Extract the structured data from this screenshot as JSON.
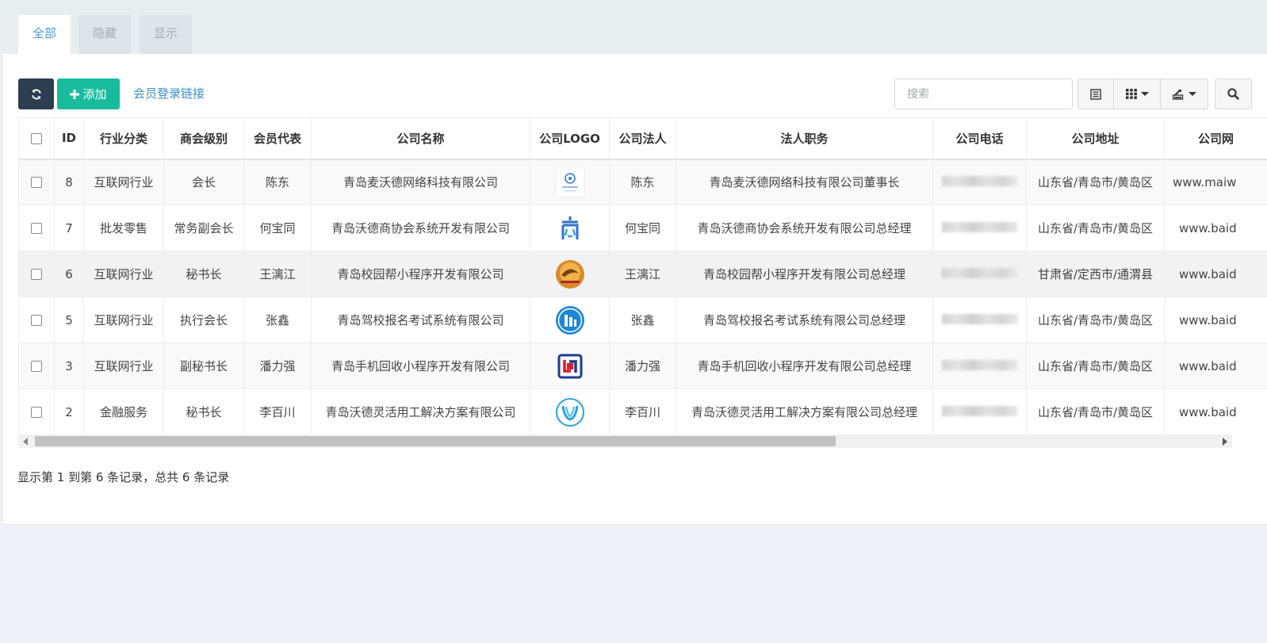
{
  "tabs": [
    {
      "label": "全部",
      "active": true
    },
    {
      "label": "隐藏",
      "active": false
    },
    {
      "label": "显示",
      "active": false
    }
  ],
  "toolbar": {
    "refresh_icon": "refresh-icon",
    "add_label": "添加",
    "add_icon": "plus-icon",
    "login_link_label": "会员登录链接",
    "search_placeholder": "搜索",
    "toggle_view_icon": "list-view-icon",
    "columns_icon": "grid-columns-icon",
    "export_icon": "export-icon",
    "search_icon": "search-icon"
  },
  "table": {
    "columns": [
      "ID",
      "行业分类",
      "商会级别",
      "会员代表",
      "公司名称",
      "公司LOGO",
      "公司法人",
      "法人职务",
      "公司电话",
      "公司地址",
      "公司网"
    ],
    "rows": [
      {
        "id": "8",
        "industry": "互联网行业",
        "level": "会长",
        "rep": "陈东",
        "company": "青岛麦沃德网络科技有限公司",
        "logo": "maiwode-logo",
        "legal": "陈东",
        "position": "青岛麦沃德网络科技有限公司董事长",
        "address": "山东省/青岛市/黄岛区",
        "website": "www.maiw"
      },
      {
        "id": "7",
        "industry": "批发零售",
        "level": "常务副会长",
        "rep": "何宝同",
        "company": "青岛沃德商协会系统开发有限公司",
        "logo": "shang-logo",
        "legal": "何宝同",
        "position": "青岛沃德商协会系统开发有限公司总经理",
        "address": "山东省/青岛市/黄岛区",
        "website": "www.baid"
      },
      {
        "id": "6",
        "industry": "互联网行业",
        "level": "秘书长",
        "rep": "王漓江",
        "company": "青岛校园帮小程序开发有限公司",
        "logo": "campus-logo",
        "legal": "王漓江",
        "position": "青岛校园帮小程序开发有限公司总经理",
        "address": "甘肃省/定西市/通渭县",
        "website": "www.baid"
      },
      {
        "id": "5",
        "industry": "互联网行业",
        "level": "执行会长",
        "rep": "张鑫",
        "company": "青岛驾校报名考试系统有限公司",
        "logo": "driving-school-logo",
        "legal": "张鑫",
        "position": "青岛驾校报名考试系统有限公司总经理",
        "address": "山东省/青岛市/黄岛区",
        "website": "www.baid"
      },
      {
        "id": "3",
        "industry": "互联网行业",
        "level": "副秘书长",
        "rep": "潘力强",
        "company": "青岛手机回收小程序开发有限公司",
        "logo": "recycle-logo",
        "legal": "潘力强",
        "position": "青岛手机回收小程序开发有限公司总经理",
        "address": "山东省/青岛市/黄岛区",
        "website": "www.baid"
      },
      {
        "id": "2",
        "industry": "金融服务",
        "level": "秘书长",
        "rep": "李百川",
        "company": "青岛沃德灵活用工解决方案有限公司",
        "logo": "flex-work-logo",
        "legal": "李百川",
        "position": "青岛沃德灵活用工解决方案有限公司总经理",
        "address": "山东省/青岛市/黄岛区",
        "website": "www.baid"
      }
    ]
  },
  "pagination": {
    "info": "显示第 1 到第 6 条记录，总共 6 条记录"
  },
  "colors": {
    "primary_dark": "#2c3e50",
    "success": "#18bc9c",
    "link": "#3a8ec8",
    "tab_active_text": "#4b9bd4"
  }
}
